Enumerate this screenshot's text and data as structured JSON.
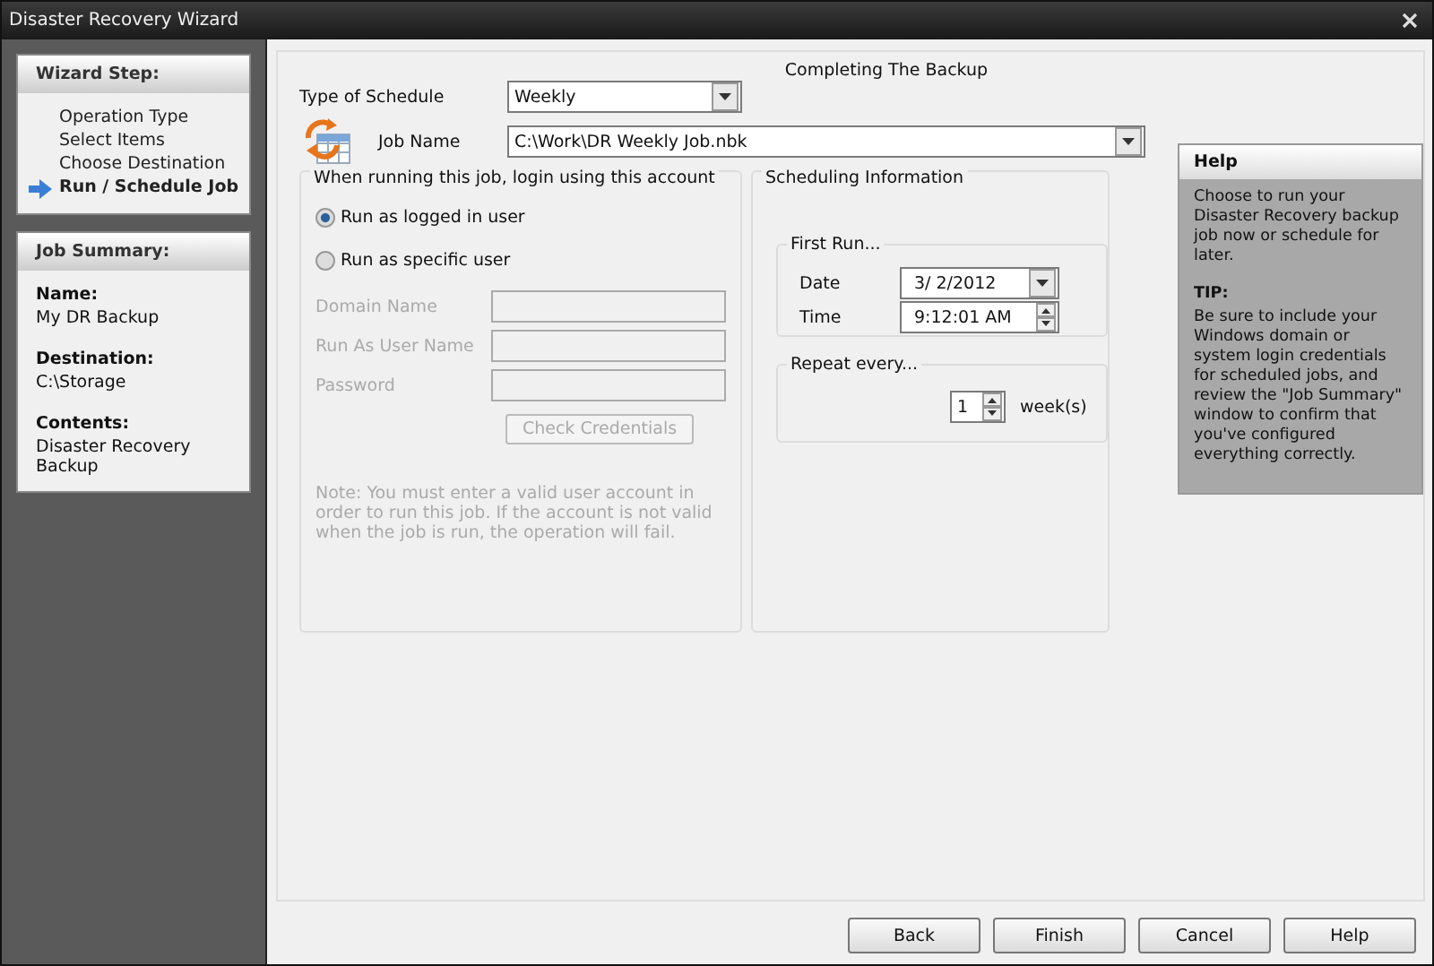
{
  "window": {
    "title": "Disaster Recovery Wizard"
  },
  "wizard_step": {
    "title": "Wizard Step:",
    "items": [
      {
        "label": "Operation Type",
        "selected": false
      },
      {
        "label": "Select Items",
        "selected": false
      },
      {
        "label": "Choose Destination",
        "selected": false
      },
      {
        "label": "Run / Schedule Job",
        "selected": true
      }
    ]
  },
  "job_summary": {
    "title": "Job Summary:",
    "fields": [
      {
        "label": "Name:",
        "value": "My DR Backup"
      },
      {
        "label": "Destination:",
        "value": "C:\\Storage"
      },
      {
        "label": "Contents:",
        "value": "Disaster Recovery Backup"
      }
    ]
  },
  "heading": "Completing The Backup",
  "schedule_type": {
    "label": "Type of Schedule",
    "value": "Weekly"
  },
  "job_name": {
    "label": "Job Name",
    "value": "C:\\Work\\DR Weekly Job.nbk"
  },
  "account": {
    "title": "When running this job, login using this account",
    "options": [
      {
        "label": "Run as logged in user",
        "selected": true
      },
      {
        "label": "Run as specific user",
        "selected": false
      }
    ],
    "fields": [
      {
        "label": "Domain Name",
        "disabled": true
      },
      {
        "label": "Run As User Name",
        "disabled": true
      },
      {
        "label": "Password",
        "disabled": true
      }
    ],
    "check_button": {
      "label": "Check Credentials",
      "disabled": true
    },
    "note": "Note: You must enter a valid user account in order to run this job. If the account is not valid when the job is run, the operation will fail."
  },
  "scheduling": {
    "title": "Scheduling Information",
    "first_run": {
      "title": "First Run...",
      "date_label": "Date",
      "date": "3/  2/2012",
      "time_label": "Time",
      "time": "9:12:01 AM"
    },
    "repeat": {
      "title": "Repeat every...",
      "value": "1",
      "unit": "week(s)"
    }
  },
  "help": {
    "title": "Help",
    "text": "Choose to run your Disaster Recovery backup job now or schedule for later.",
    "tip_title": "TIP:",
    "tip": "Be sure to include your Windows domain or system login credentials for scheduled jobs, and review the \"Job Summary\" window to confirm that you've configured everything correctly."
  },
  "buttons": [
    "Back",
    "Finish",
    "Cancel",
    "Help"
  ]
}
